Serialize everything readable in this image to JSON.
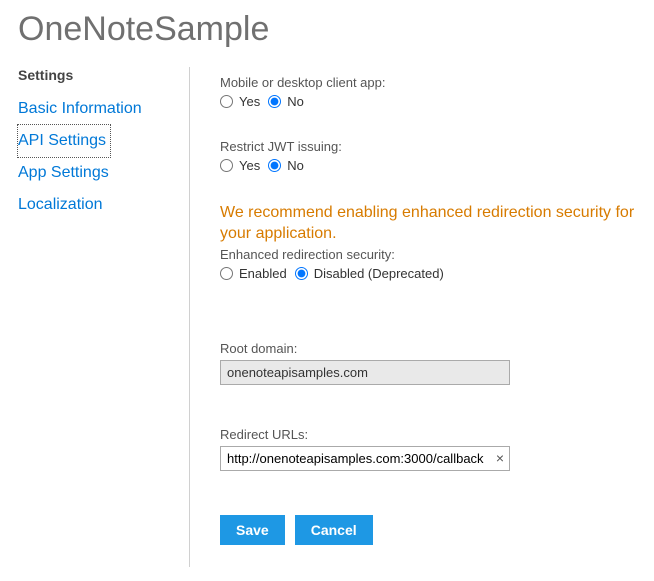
{
  "header": {
    "title": "OneNoteSample"
  },
  "sidebar": {
    "heading": "Settings",
    "items": [
      {
        "label": "Basic Information"
      },
      {
        "label": "API Settings"
      },
      {
        "label": "App Settings"
      },
      {
        "label": "Localization"
      }
    ]
  },
  "main": {
    "mobileDesktop": {
      "label": "Mobile or desktop client app:",
      "yes": "Yes",
      "no": "No"
    },
    "restrictJwt": {
      "label": "Restrict JWT issuing:",
      "yes": "Yes",
      "no": "No"
    },
    "recommendation": "We recommend enabling enhanced redirection security for your application.",
    "enhanced": {
      "label": "Enhanced redirection security:",
      "enabled": "Enabled",
      "disabled": "Disabled (Deprecated)"
    },
    "rootDomain": {
      "label": "Root domain:",
      "value": "onenoteapisamples.com"
    },
    "redirect": {
      "label": "Redirect URLs:",
      "value": "http://onenoteapisamples.com:3000/callback"
    },
    "buttons": {
      "save": "Save",
      "cancel": "Cancel"
    }
  }
}
